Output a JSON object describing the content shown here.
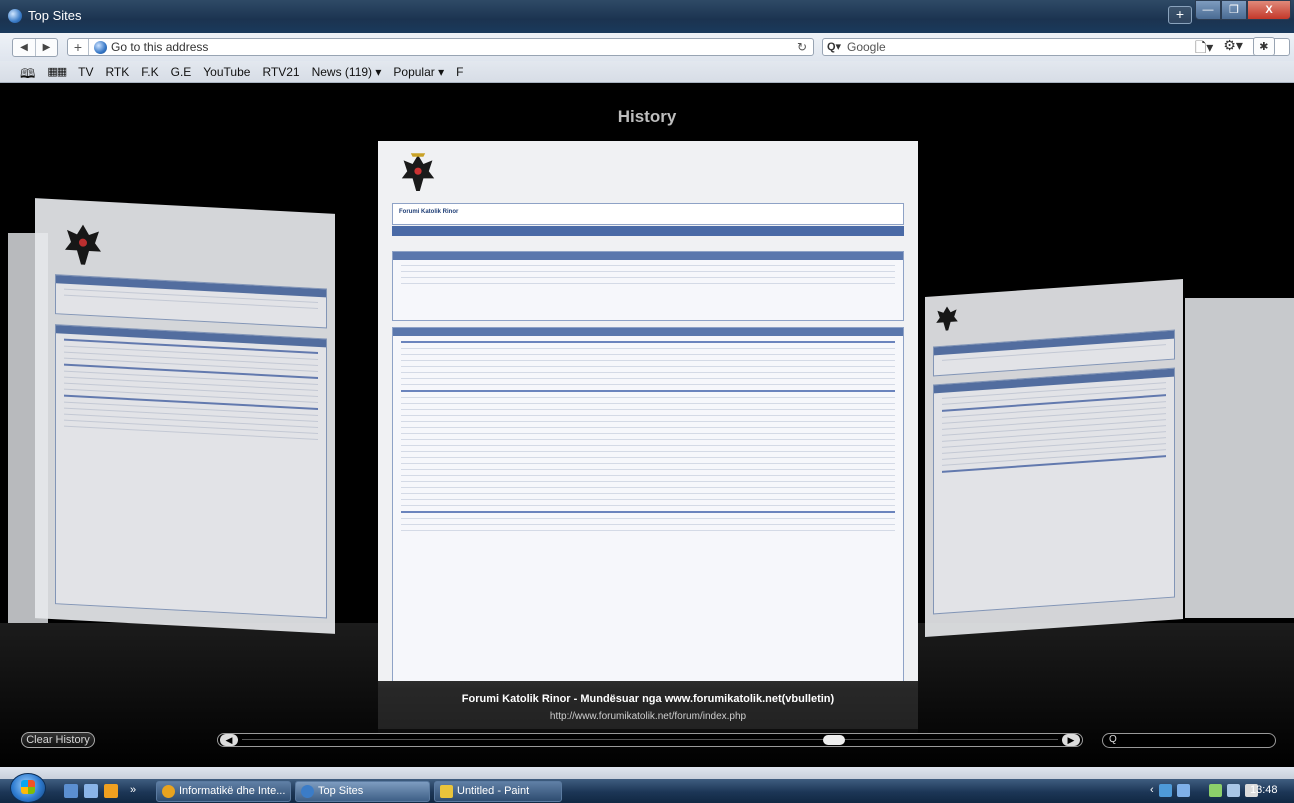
{
  "window": {
    "title": "Top Sites",
    "new_tab": "+",
    "minimize": "—",
    "maximize": "❐",
    "close": "X"
  },
  "toolbar": {
    "back": "◀",
    "forward": "▶",
    "add": "+",
    "address_placeholder": "Go to this address",
    "reload": "↻",
    "search_placeholder": "Google",
    "search_icon": "Q▾",
    "page_menu": "🗋▾",
    "settings_menu": "⚙▾",
    "bug": "✱"
  },
  "bookmarks": {
    "book_icon": "🕮",
    "grid_icon": "▦▦",
    "items": [
      "TV",
      "RTK",
      "F.K",
      "G.E",
      "YouTube",
      "RTV21",
      "News (119) ▾",
      "Popular ▾",
      "F"
    ]
  },
  "topsites": {
    "header": "History",
    "forum_title": "Forumi Katolik Rinor",
    "caption_title": "Forumi Katolik Rinor - Mundësuar nga www.forumikatolik.net(vbulletin)",
    "caption_url": "http://www.forumikatolik.net/forum/index.php",
    "clear_history": "Clear History",
    "scroll_left": "◀",
    "scroll_right": "▶",
    "history_search_icon": "Q",
    "history_search_value": "",
    "scroll_position": 0.73
  },
  "taskbar": {
    "more": "»",
    "tasks": [
      {
        "label": "Informatikë dhe Inte...",
        "icon_color": "#e8a31f"
      },
      {
        "label": "Top Sites",
        "icon_color": "#3b7cc7"
      },
      {
        "label": "Untitled - Paint",
        "icon_color": "#e9c43b"
      }
    ],
    "tray_arrow": "‹",
    "clock": "13:48"
  },
  "colors": {
    "forum_blue": "#4a6aa6",
    "titlebar": "#1b3350",
    "close_red": "#c4382a"
  }
}
